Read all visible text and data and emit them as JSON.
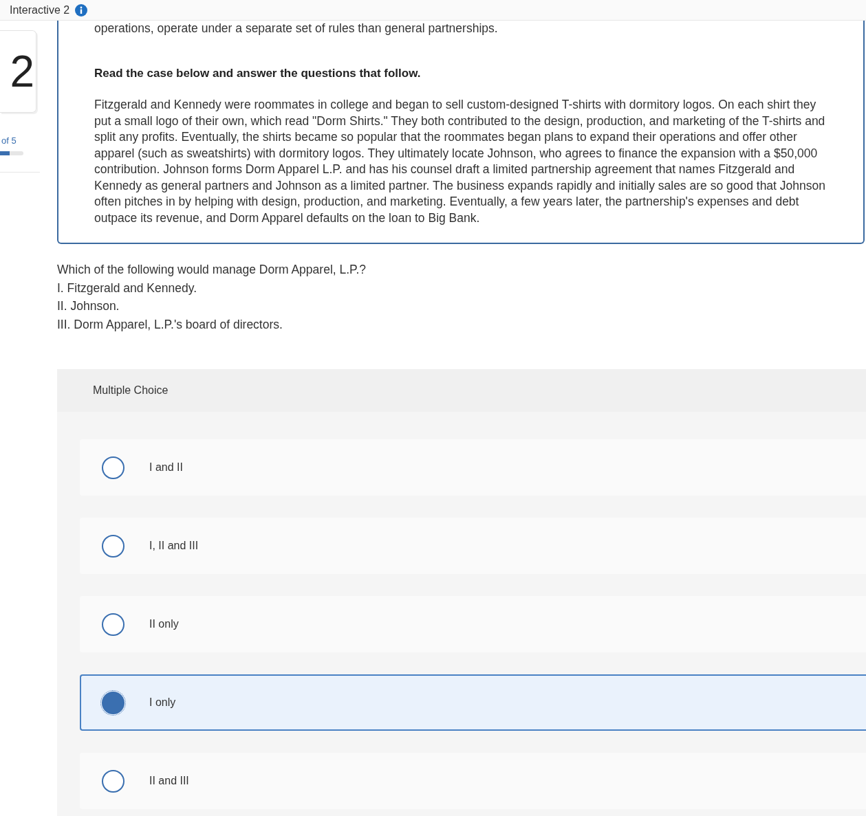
{
  "header": {
    "title": "Interactive 2"
  },
  "sidebar": {
    "question_number": "2",
    "progress_text": "of 5",
    "level": 0.4
  },
  "case": {
    "intro_tail": "operations, operate under a separate set of rules than general partnerships.",
    "instruction": "Read the case below and answer the questions that follow.",
    "passage": "Fitzgerald and Kennedy were roommates in college and began to sell custom-designed T-shirts with dormitory logos. On each shirt they put a small logo of their own, which read \"Dorm Shirts.\" They both contributed to the design, production, and marketing of the T-shirts and split any profits. Eventually, the shirts became so popular that the roommates began plans to expand their operations and offer other apparel (such as sweatshirts) with dormitory logos. They ultimately locate Johnson, who agrees to finance the expansion with a $50,000 contribution. Johnson forms Dorm Apparel L.P. and has his counsel draft a limited partnership agreement that names Fitzgerald and Kennedy as general partners and Johnson as a limited partner. The business expands rapidly and initially sales are so good that Johnson often pitches in by helping with design, production, and marketing. Eventually, a few years later, the partnership's expenses and debt outpace its revenue, and Dorm Apparel defaults on the loan to Big Bank."
  },
  "question": {
    "lines": [
      "Which of the following would manage Dorm Apparel, L.P.?",
      "I. Fitzgerald and Kennedy.",
      "II. Johnson.",
      "III. Dorm Apparel, L.P.'s board of directors."
    ]
  },
  "answers": {
    "label": "Multiple Choice",
    "options": [
      {
        "text": "I and II",
        "selected": false
      },
      {
        "text": "I, II and III",
        "selected": false
      },
      {
        "text": "II only",
        "selected": false
      },
      {
        "text": "I only",
        "selected": true
      },
      {
        "text": "II and III",
        "selected": false
      }
    ]
  }
}
